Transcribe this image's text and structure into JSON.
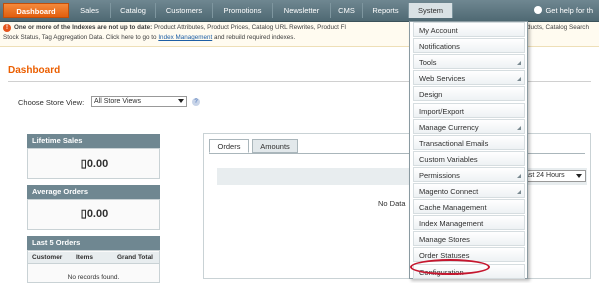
{
  "nav": {
    "items": [
      "Dashboard",
      "Sales",
      "Catalog",
      "Customers",
      "Promotions",
      "Newsletter",
      "CMS",
      "Reports",
      "System"
    ],
    "help": "Get help for th"
  },
  "message": {
    "line1_bold": "One or more of the Indexes are not up to date:",
    "line1": " Product Attributes, Product Prices, Catalog URL Rewrites, Product Fl",
    "line1_tail": "ducts, Catalog Search",
    "line2_pre": "Stock Status, Tag Aggregation Data. Click here to go to ",
    "line2_link": "Index Management",
    "line2_post": " and rebuild required indexes."
  },
  "page": {
    "title": "Dashboard",
    "store_label": "Choose Store View:",
    "store_value": "All Store Views"
  },
  "panels": {
    "lifetime_sales": {
      "title": "Lifetime Sales",
      "value": "▯0.00"
    },
    "average_orders": {
      "title": "Average Orders",
      "value": "▯0.00"
    },
    "last_orders": {
      "title": "Last 5 Orders",
      "columns": [
        "Customer",
        "Items",
        "Grand Total"
      ],
      "empty": "No records found."
    }
  },
  "right": {
    "tabs": [
      "Orders",
      "Amounts"
    ],
    "period": "ast 24 Hours",
    "nodata": "No Data"
  },
  "system_menu": {
    "items": [
      "My Account",
      "Notifications",
      "Tools",
      "Web Services",
      "Design",
      "Import/Export",
      "Manage Currency",
      "Transactional Emails",
      "Custom Variables",
      "Permissions",
      "Magento Connect",
      "Cache Management",
      "Index Management",
      "Manage Stores",
      "Order Statuses",
      "Configuration"
    ],
    "submenu_flags": [
      false,
      false,
      true,
      true,
      false,
      false,
      true,
      false,
      false,
      true,
      true,
      false,
      false,
      false,
      false,
      false
    ],
    "highlighted": "Configuration"
  },
  "colors": {
    "accent": "#eb5e00",
    "nav_bg": "#56707a",
    "highlight_circle": "#c5162e"
  }
}
